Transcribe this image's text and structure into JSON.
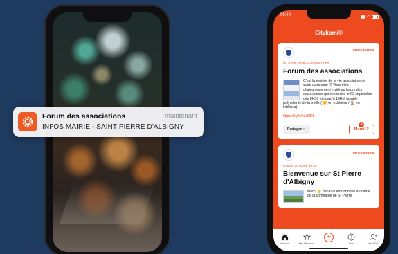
{
  "notification": {
    "title": "Forum des associations",
    "time": "maintenant",
    "body": "INFOS MAIRIE - SAINT PIERRE D'ALBIGNY",
    "icon": "citykomi-app-icon"
  },
  "phone": {
    "status_time": "09:49",
    "app_title": "Citykomi®"
  },
  "cards": [
    {
      "source": "INFOS MAIRIE",
      "date": "Du 03/09 08:30 au 03/09 19:00",
      "title": "Forum des associations",
      "body": "C'est la rentrée de la vie associative de votre commune !!! Vous êtes chaleureusement invité au forum des associations qui se tiendra le 03 septembre dès 8H30 et jusqu'à 19H à la salle polyvalente de la treille ( 🌞 en extérieur / 🏠 en intérieur).",
      "link": "https://iky.fr/eLdMR5",
      "share_label": "Partager",
      "thanks_label": "Merci",
      "thanks_count": "3"
    },
    {
      "source": "INFOS MAIRIE",
      "date": "A partir du 03/09 09:26",
      "title": "Bienvenue sur St Pierre d'Albigny",
      "body": "Merci 👍 de vous être abonné au canal de la commune de St Pierre"
    }
  ],
  "tabs": [
    {
      "label": "Mes infos",
      "icon": "home-icon"
    },
    {
      "label": "Mes Diffuseurs",
      "icon": "star-icon"
    },
    {
      "label": "",
      "icon": "plus-icon"
    },
    {
      "label": "Aide",
      "icon": "help-icon"
    },
    {
      "label": "Mon KOM",
      "icon": "user-icon"
    }
  ],
  "colors": {
    "background": "#1f3a5f",
    "brand": "#ee4a1f"
  }
}
